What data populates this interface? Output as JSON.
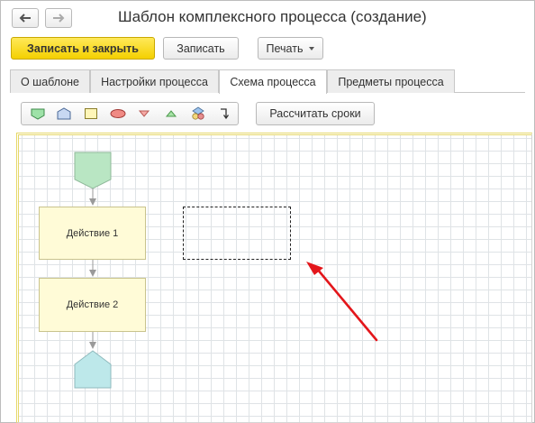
{
  "window": {
    "title": "Шаблон комплексного процесса (создание)"
  },
  "toolbar": {
    "save_close_label": "Записать и закрыть",
    "save_label": "Записать",
    "print_label": "Печать"
  },
  "tabs": [
    {
      "label": "О шаблоне",
      "active": false
    },
    {
      "label": "Настройки процесса",
      "active": false
    },
    {
      "label": "Схема процесса",
      "active": true
    },
    {
      "label": "Предметы процесса",
      "active": false
    }
  ],
  "scheme_toolbar": {
    "icons": [
      "start-point-icon",
      "end-point-icon",
      "action-icon",
      "condition-icon",
      "split-icon",
      "merge-icon",
      "nested-process-icon",
      "connector-icon"
    ],
    "calc_label": "Рассчитать сроки"
  },
  "scheme": {
    "blocks": [
      {
        "label": "Действие 1"
      },
      {
        "label": "Действие 2"
      }
    ]
  },
  "colors": {
    "accent_button": "#f4d000",
    "start_point": "#b9e6c3",
    "end_point": "#bde8ea",
    "action_block": "#fffbd7",
    "annotation_arrow": "#e3161b"
  }
}
